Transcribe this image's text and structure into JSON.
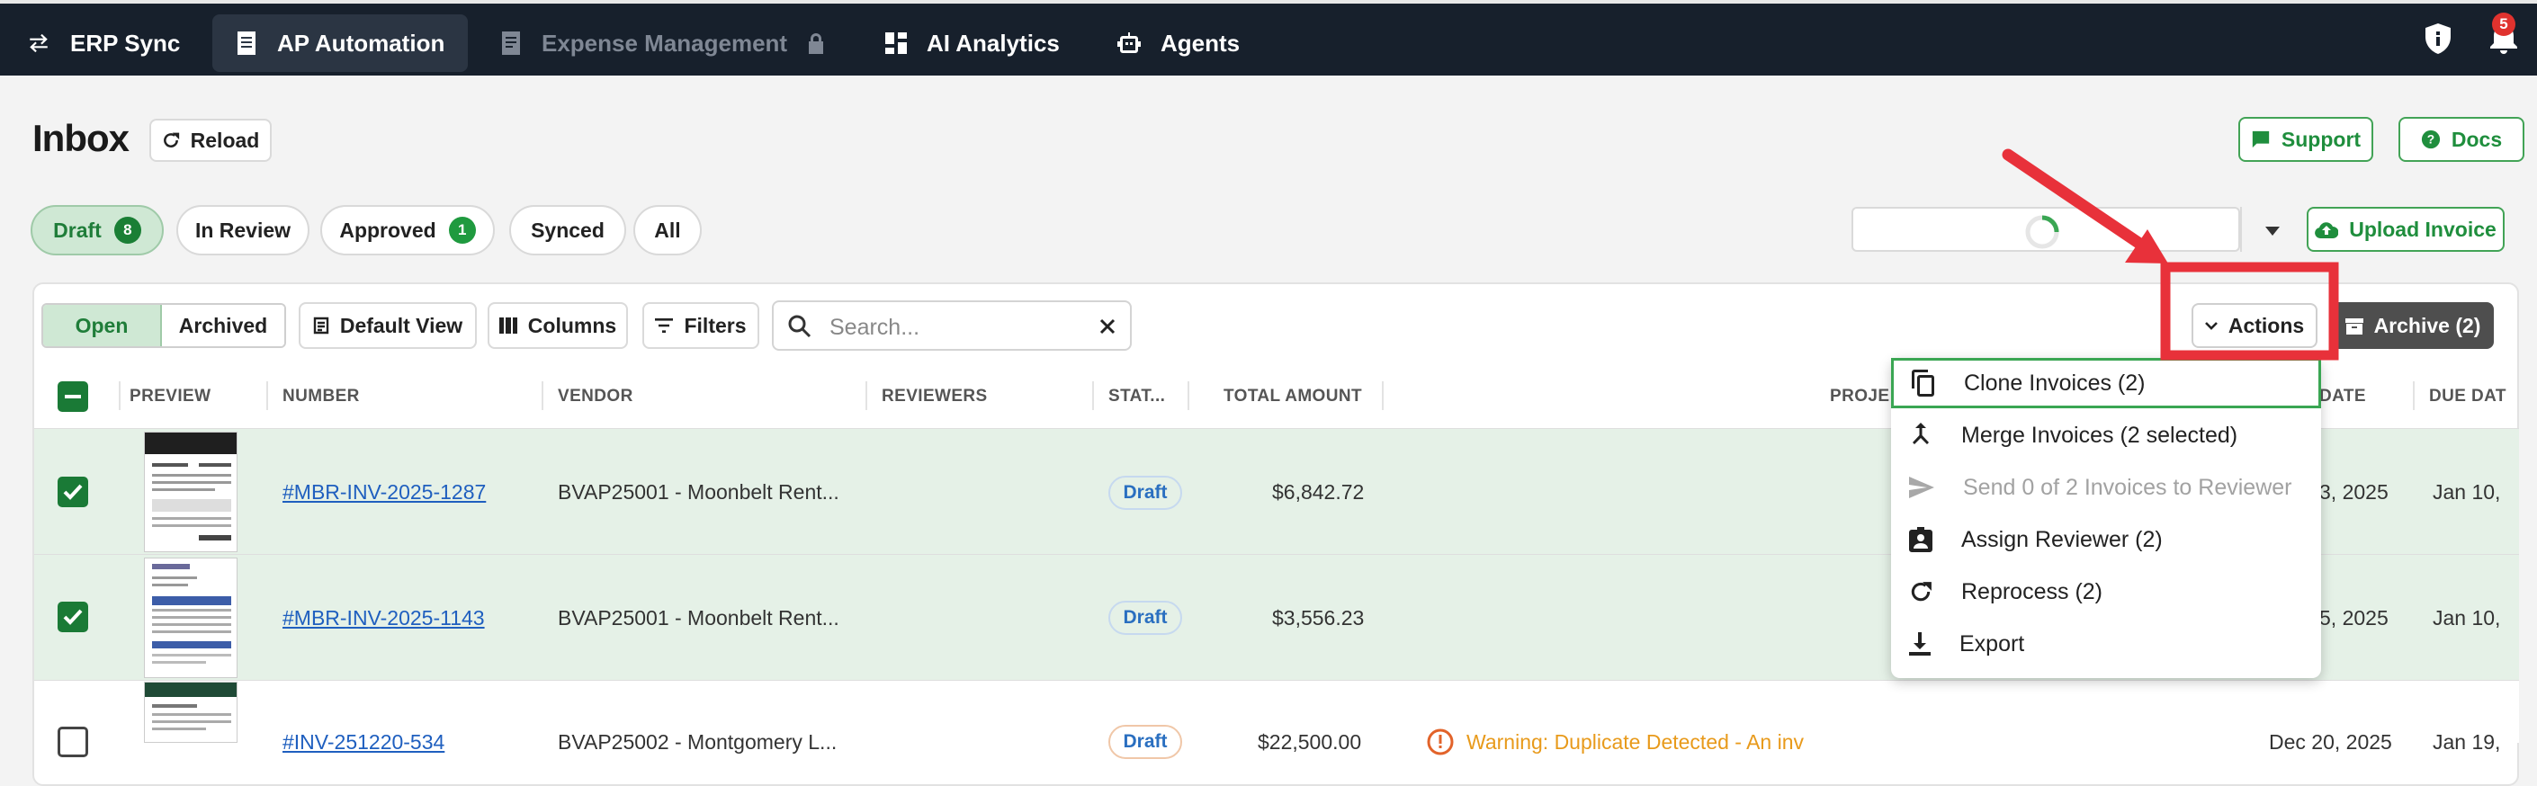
{
  "nav": {
    "erp_sync": "ERP Sync",
    "ap_automation": "AP Automation",
    "expense_management": "Expense Management",
    "ai_analytics": "AI Analytics",
    "agents": "Agents",
    "notification_count": "5"
  },
  "header": {
    "title": "Inbox",
    "reload": "Reload",
    "support": "Support",
    "docs": "Docs",
    "upload_invoice": "Upload Invoice"
  },
  "status_tabs": [
    {
      "label": "Draft",
      "count": "8"
    },
    {
      "label": "In Review"
    },
    {
      "label": "Approved",
      "count": "1"
    },
    {
      "label": "Synced"
    },
    {
      "label": "All"
    }
  ],
  "toolbar": {
    "open": "Open",
    "archived": "Archived",
    "default_view": "Default View",
    "columns": "Columns",
    "filters": "Filters",
    "search_placeholder": "Search...",
    "actions": "Actions",
    "archive": "Archive (2)"
  },
  "columns": [
    "PREVIEW",
    "NUMBER",
    "VENDOR",
    "REVIEWERS",
    "STAT...",
    "TOTAL AMOUNT",
    "PROJE",
    "DATE",
    "DUE DAT"
  ],
  "rows": [
    {
      "number": "#MBR-INV-2025-1287",
      "vendor": "BVAP25001 - Moonbelt Rent...",
      "status": "Draft",
      "amount": "$6,842.72",
      "date": "3, 2025",
      "due": "Jan 10,"
    },
    {
      "number": "#MBR-INV-2025-1143",
      "vendor": "BVAP25001 - Moonbelt Rent...",
      "status": "Draft",
      "amount": "$3,556.23",
      "date": "5, 2025",
      "due": "Jan 10,"
    },
    {
      "number": "#INV-251220-534",
      "vendor": "BVAP25002 - Montgomery L...",
      "status": "Draft",
      "amount": "$22,500.00",
      "warning": "Warning: Duplicate Detected - An inv",
      "date": "Dec 20, 2025",
      "due": "Jan 19,"
    }
  ],
  "actions_menu": [
    {
      "label": "Clone Invoices (2)",
      "icon": "copy-icon"
    },
    {
      "label": "Merge Invoices (2 selected)",
      "icon": "merge-icon"
    },
    {
      "label": "Send 0 of 2 Invoices to Reviewer",
      "icon": "send-icon",
      "disabled": true
    },
    {
      "label": "Assign Reviewer (2)",
      "icon": "assign-reviewer-icon"
    },
    {
      "label": "Reprocess (2)",
      "icon": "refresh-icon"
    },
    {
      "label": "Export",
      "icon": "download-icon"
    }
  ],
  "colors": {
    "topbar": "#17202c",
    "accent_green": "#1f8e3d",
    "annotation_red": "#e8313a",
    "link_blue": "#1f5fbf"
  }
}
